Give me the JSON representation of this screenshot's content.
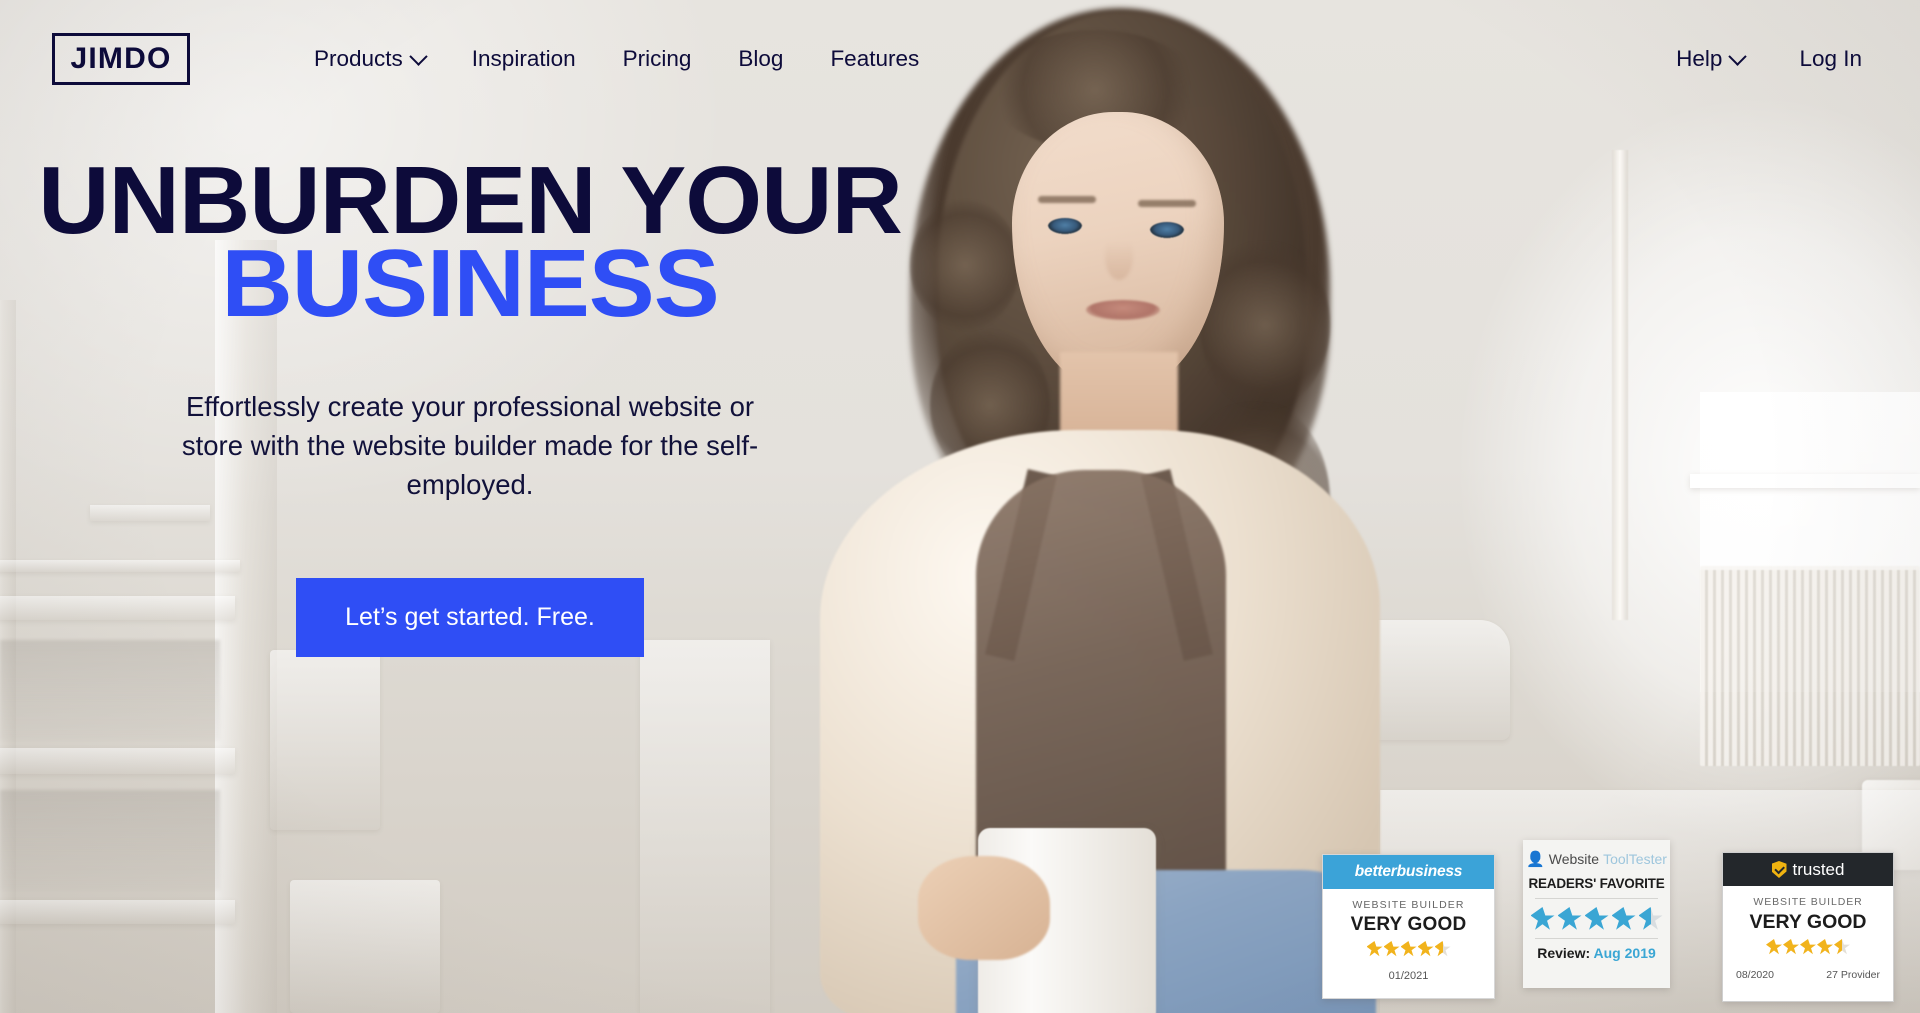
{
  "brand": {
    "logo_text": "JIMDO",
    "accent_blue": "#2f4ef5",
    "navy": "#0d0b3a"
  },
  "header": {
    "nav_items": [
      {
        "label": "Products",
        "has_dropdown": true,
        "icon": "chevron-down-icon"
      },
      {
        "label": "Inspiration",
        "has_dropdown": false
      },
      {
        "label": "Pricing",
        "has_dropdown": false
      },
      {
        "label": "Blog",
        "has_dropdown": false
      },
      {
        "label": "Features",
        "has_dropdown": false
      }
    ],
    "right_items": [
      {
        "label": "Help",
        "has_dropdown": true,
        "icon": "chevron-down-icon"
      },
      {
        "label": "Log In",
        "has_dropdown": false
      }
    ]
  },
  "hero": {
    "headline_line1": "UNBURDEN YOUR",
    "headline_line2": "BUSINESS",
    "subcopy": "Effortlessly create your professional website or store with the website builder made for the self-employed.",
    "cta_label": "Let’s get started. Free."
  },
  "badges": [
    {
      "id": "better-business",
      "brand_part1": "better",
      "brand_part2": "business",
      "category": "WEBSITE BUILDER",
      "grade": "VERY GOOD",
      "rating": 4.5,
      "star_color": "gold",
      "date": "01/2021"
    },
    {
      "id": "website-tool-tester",
      "brand_part1": "Website",
      "brand_part2": "ToolTester",
      "title": "READERS' FAVORITE",
      "rating": 4.5,
      "star_color": "blue",
      "review_label": "Review:",
      "review_date": "Aug 2019"
    },
    {
      "id": "trusted",
      "brand": "trusted",
      "brand_icon": "shield-check-icon",
      "category": "WEBSITE BUILDER",
      "grade": "VERY GOOD",
      "rating": 4.5,
      "star_color": "gold",
      "date": "08/2020",
      "providers": "27 Provider"
    }
  ]
}
